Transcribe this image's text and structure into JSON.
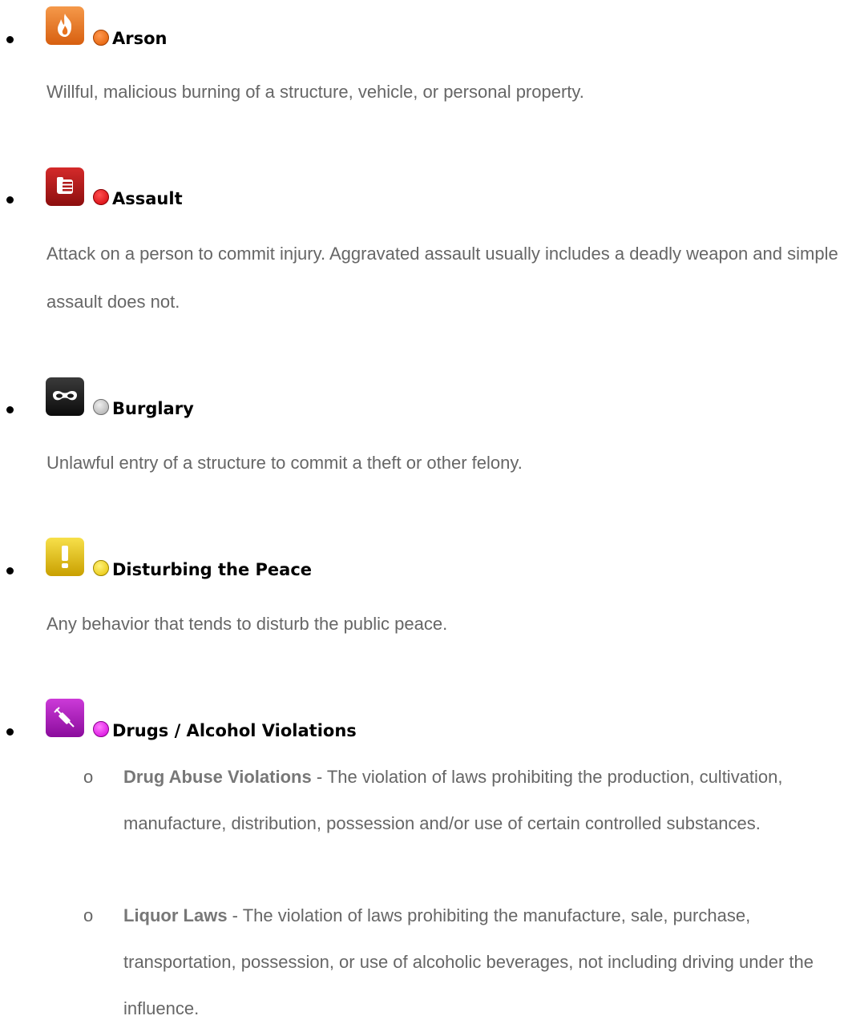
{
  "categories": [
    {
      "title": "Arson",
      "description": "Willful, malicious burning of a structure, vehicle, or personal property.",
      "icon": "fire-icon",
      "icon_color": "#e8731e",
      "dot_color": "#ee6a10"
    },
    {
      "title": "Assault",
      "description": "Attack on a person to commit injury. Aggravated assault usually includes a deadly weapon and simple assault does not.",
      "icon": "fist-icon",
      "icon_color": "#b01818",
      "dot_color": "#e8141a"
    },
    {
      "title": "Burglary",
      "description": "Unlawful entry of a structure to commit a theft or other felony.",
      "icon": "mask-icon",
      "icon_color": "#1a1a1a",
      "dot_color": "#c8c8c8"
    },
    {
      "title": "Disturbing the Peace",
      "description": "Any behavior that tends to disturb the public peace.",
      "icon": "exclamation-icon",
      "icon_color": "#e2c010",
      "dot_color": "#f2d81a"
    },
    {
      "title": "Drugs / Alcohol Violations",
      "icon": "syringe-icon",
      "icon_color": "#a818b8",
      "dot_color": "#e21ae8",
      "subitems": [
        {
          "marker": "o",
          "term": "Drug Abuse Violations",
          "text": " - The violation of laws prohibiting the production, cultivation, manufacture, distribution, possession and/or use of certain controlled substances."
        },
        {
          "marker": "o",
          "term": "Liquor Laws",
          "text": " - The violation of laws prohibiting the manufacture, sale, purchase, transportation, possession, or use of alcoholic beverages, not including driving under the influence."
        }
      ]
    }
  ]
}
